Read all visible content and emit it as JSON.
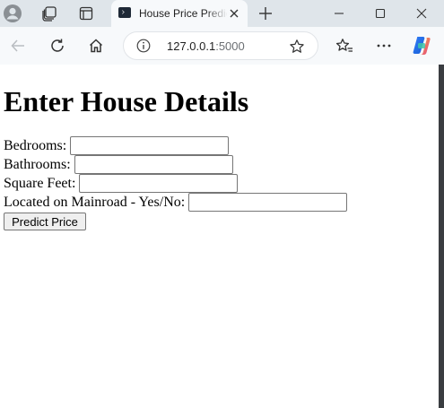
{
  "browser": {
    "tab": {
      "title": "House Price Prediction"
    },
    "address_bar": {
      "url_host": "127.0.0.1",
      "url_port": ":5000"
    }
  },
  "form": {
    "heading": "Enter House Details",
    "fields": [
      {
        "label": "Bedrooms:",
        "value": ""
      },
      {
        "label": "Bathrooms:",
        "value": ""
      },
      {
        "label": "Square Feet:",
        "value": ""
      },
      {
        "label": "Located on Mainroad - Yes/No:",
        "value": ""
      }
    ],
    "submit_label": "Predict Price"
  },
  "colors": {
    "tabbar_bg": "#dfe5ea",
    "toolbar_bg": "#f7f9fb",
    "button_bg": "#efefef"
  },
  "icons": [
    "profile-icon",
    "workspaces-icon",
    "tab-actions-icon",
    "terminal-favicon",
    "close-tab-icon",
    "new-tab-icon",
    "minimize-icon",
    "maximize-icon",
    "close-window-icon",
    "back-icon",
    "refresh-icon",
    "home-icon",
    "info-icon",
    "favorite-star-icon",
    "favorites-icon",
    "more-icon",
    "copilot-icon"
  ]
}
